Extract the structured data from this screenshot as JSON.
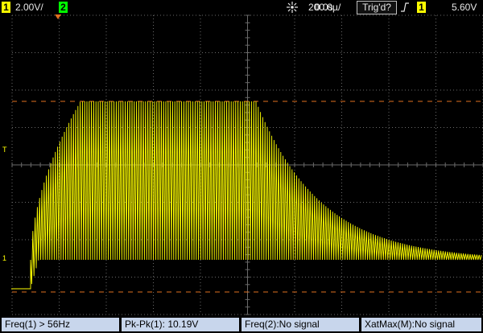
{
  "topbar": {
    "ch1_badge": "1",
    "ch1_scale": "2.00V/",
    "ch2_badge": "2",
    "time_offset": "0.0s",
    "time_scale": "200.0µ/",
    "trigger_status": "Trig'd?",
    "trigger_source_badge": "1",
    "trigger_level": "5.60V"
  },
  "measurements": [
    {
      "label": "Freq(1) > 56Hz"
    },
    {
      "label": "Pk-Pk(1): 10.19V"
    },
    {
      "label": "Freq(2):No signal"
    },
    {
      "label": "XatMax(M):No signal"
    }
  ],
  "markers": {
    "trigger_level_marker": "T",
    "ch1_ground_marker": "1"
  },
  "colors": {
    "ch1": "#ffff00",
    "ch2": "#00ff00",
    "grid": "#6a6a6a",
    "cursor_lines": "#e07020",
    "measurement_bg": "#c8d6ec"
  }
}
